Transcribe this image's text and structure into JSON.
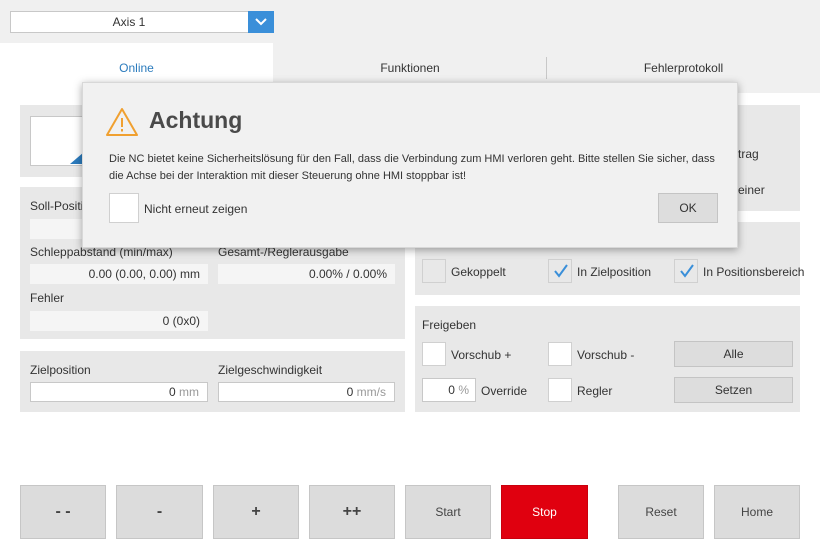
{
  "axis_select": {
    "value": "Axis 1"
  },
  "tabs": [
    {
      "label": "Online",
      "active": true
    },
    {
      "label": "Funktionen",
      "active": false
    },
    {
      "label": "Fehlerprotokoll",
      "active": false
    }
  ],
  "left": {
    "soll_position_label": "Soll-Position",
    "schleppabstand_label": "Schleppabstand (min/max)",
    "schleppabstand_value": "0.00 (0.00, 0.00) mm",
    "gesamt_label": "Gesamt-/Reglerausgabe",
    "gesamt_value": "0.00% / 0.00%",
    "fehler_label": "Fehler",
    "fehler_value": "0 (0x0)",
    "zielposition_label": "Zielposition",
    "zielposition_value": "0",
    "zielposition_unit": "mm",
    "zielgeschw_label": "Zielgeschwindigkeit",
    "zielgeschw_value": "0",
    "zielgeschw_unit": "mm/s"
  },
  "right": {
    "partial_trag": "trag",
    "partial_einer": "einer",
    "status": {
      "gekoppelt": {
        "label": "Gekoppelt",
        "checked": false
      },
      "in_zielposition": {
        "label": "In Zielposition",
        "checked": true
      },
      "in_positionsbereich": {
        "label": "In Positionsbereich",
        "checked": true
      }
    },
    "freigeben": {
      "title": "Freigeben",
      "vorschub_plus": "Vorschub +",
      "vorschub_minus": "Vorschub -",
      "alle": "Alle",
      "override_value": "0",
      "override_unit": "%",
      "override_label": "Override",
      "regler": "Regler",
      "setzen": "Setzen"
    }
  },
  "bottom_buttons": {
    "fast_minus": "- -",
    "minus": "-",
    "plus": "+",
    "fast_plus": "++",
    "start": "Start",
    "stop": "Stop",
    "reset": "Reset",
    "home": "Home"
  },
  "dialog": {
    "title": "Achtung",
    "message": "Die NC bietet keine Sicherheitslösung für den Fall, dass die Verbindung zum HMI verloren geht. Bitte stellen Sie sicher, dass die Achse bei der Interaktion mit dieser Steuerung ohne HMI stoppbar ist!",
    "checkbox_label": "Nicht erneut zeigen",
    "ok": "OK"
  },
  "colors": {
    "accent": "#3a8fd9",
    "stop": "#e0000f",
    "warning": "#f0a030"
  }
}
